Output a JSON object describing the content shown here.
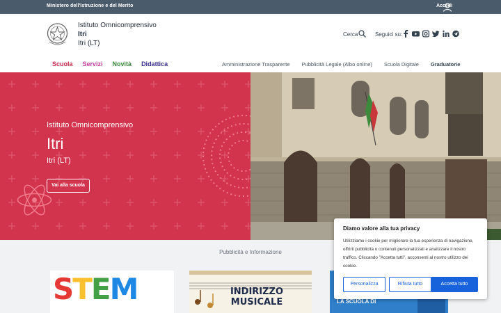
{
  "topbar": {
    "ministry": "Ministero dell'Istruzione e del Merito",
    "login": "Accedi",
    "login_icon": "user-icon"
  },
  "header": {
    "school_type": "Istituto Omnicomprensivo",
    "school_name": "Itri",
    "school_location": "Itri (LT)",
    "search_label": "Cerca",
    "social_label": "Seguici su:",
    "social_icons": [
      "facebook-icon",
      "youtube-icon",
      "instagram-icon",
      "twitter-icon",
      "linkedin-icon",
      "telegram-icon"
    ]
  },
  "main_nav": [
    "Scuola",
    "Servizi",
    "Novità",
    "Didattica"
  ],
  "secondary_nav": [
    "Amministrazione Trasparente",
    "Pubblicità Legale (Albo online)",
    "Scuola Digitale",
    "Graduatorie"
  ],
  "hero": {
    "type": "Istituto Omnicomprensivo",
    "name": "Itri",
    "location": "Itri (LT)",
    "button": "Vai alla scuola"
  },
  "section": {
    "title": "Pubblicità e Informazione",
    "cards": [
      {
        "text": "STEM"
      },
      {
        "text_line1": "INDIRIZZO",
        "text_line2": "MUSICALE"
      },
      {
        "text": "LA SCUOLA DI"
      }
    ]
  },
  "cookie": {
    "title": "Diamo valore alla tua privacy",
    "body": "Utilizziamo i cookie per migliorare la tua esperienza di navigazione, offrirti pubblicità o contenuti personalizzati e analizzare il nostro traffico. Cliccando \"Accetta tutti\", acconsenti al nostro utilizzo dei cookie.",
    "customize": "Personalizza",
    "reject": "Rifiuta tutto",
    "accept": "Accetta tutto"
  },
  "colors": {
    "topbar": "#4a5b6c",
    "hero_red": "#d2334d",
    "nav_scuola": "#c5294b",
    "nav_servizi": "#c23d9a",
    "nav_novita": "#3a8a3a",
    "nav_didattica": "#3a2e91",
    "cookie_button": "#1863dc"
  }
}
